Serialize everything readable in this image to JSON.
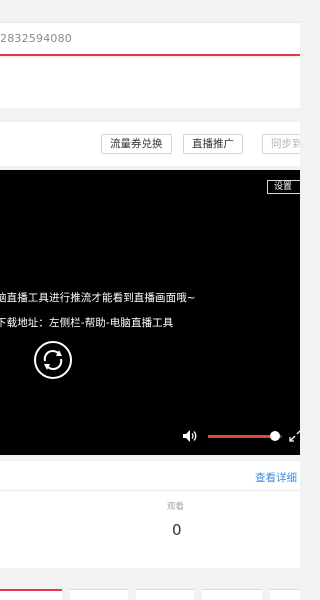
{
  "url_bar": {
    "text": "2832594080"
  },
  "toolbar": {
    "exchange_label": "流量券兑换",
    "promotion_label": "直播推广",
    "sync_label": "同步到"
  },
  "player": {
    "settings_label": "设置",
    "hint_line_1": "脑直播工具进行推流才能看到直播画面哦~",
    "hint_line_2": "下载地址：左侧栏-帮助-电脑直播工具",
    "volume_level": 0.9,
    "colors": {
      "volume_accent": "#e8452c"
    }
  },
  "stats": {
    "detail_link": "查看详细",
    "metric_label": "观看",
    "metric_value": "0"
  },
  "icons": {
    "refresh": "refresh-icon",
    "volume": "volume-icon",
    "fullscreen": "fullscreen-icon"
  },
  "colors": {
    "brand_red": "#e8374c",
    "link_blue": "#3a8ee6"
  }
}
